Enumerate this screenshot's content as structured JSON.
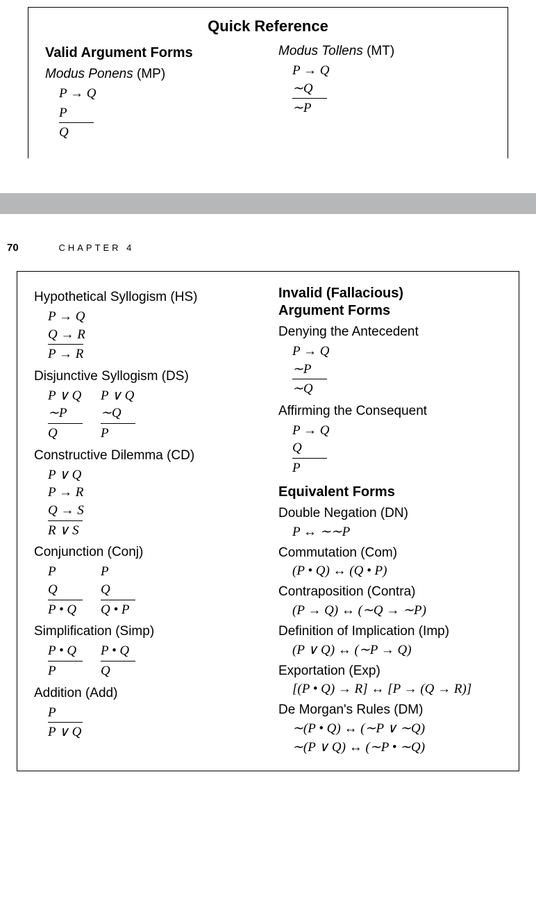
{
  "topBox": {
    "title": "Quick Reference",
    "validHeading": "Valid Argument Forms",
    "mp": {
      "name": "Modus Ponens",
      "abbr": "(MP)",
      "p1": "P → Q",
      "p2": "P",
      "c": "Q"
    },
    "mt": {
      "name": "Modus Tollens",
      "abbr": "(MT)",
      "p1": "P → Q",
      "p2": "∼Q",
      "c": "∼P"
    }
  },
  "pageHeader": {
    "page": "70",
    "chapter": "CHAPTER  4"
  },
  "left": {
    "hs": {
      "name": "Hypothetical Syllogism (HS)",
      "p1": "P → Q",
      "p2": "Q → R",
      "c": "P → R"
    },
    "ds": {
      "name": "Disjunctive Syllogism (DS)",
      "v1": {
        "p1": "P ∨ Q",
        "p2": "∼P",
        "c": "Q"
      },
      "v2": {
        "p1": "P ∨ Q",
        "p2": "∼Q",
        "c": "P"
      }
    },
    "cd": {
      "name": "Constructive Dilemma (CD)",
      "p1": "P ∨ Q",
      "p2": "P → R",
      "p3": "Q → S",
      "c": "R ∨ S"
    },
    "conj": {
      "name": "Conjunction (Conj)",
      "v1": {
        "p1": "P",
        "p2": "Q",
        "c": "P • Q"
      },
      "v2": {
        "p1": "P",
        "p2": "Q",
        "c": "Q • P"
      }
    },
    "simp": {
      "name": "Simplification (Simp)",
      "v1": {
        "p1": "P • Q",
        "c": "P"
      },
      "v2": {
        "p1": "P • Q",
        "c": "Q"
      }
    },
    "add": {
      "name": "Addition (Add)",
      "p1": "P",
      "c": "P ∨ Q"
    }
  },
  "right": {
    "invalidHeading1": "Invalid (Fallacious)",
    "invalidHeading2": "Argument Forms",
    "da": {
      "name": "Denying the Antecedent",
      "p1": "P → Q",
      "p2": "∼P",
      "c": "∼Q"
    },
    "ac": {
      "name": "Affirming the Consequent",
      "p1": "P → Q",
      "p2": "Q",
      "c": "P"
    },
    "equivHeading": "Equivalent Forms",
    "dn": {
      "name": "Double Negation (DN)",
      "eq": "P ↔ ∼∼P"
    },
    "com": {
      "name": "Commutation (Com)",
      "eq": "(P • Q) ↔ (Q • P)"
    },
    "contra": {
      "name": "Contraposition (Contra)",
      "eq": "(P → Q) ↔ (∼Q → ∼P)"
    },
    "imp": {
      "name": "Definition of Implication (Imp)",
      "eq": "(P ∨ Q) ↔ (∼P → Q)"
    },
    "exp": {
      "name": "Exportation (Exp)",
      "eq": "[(P • Q) → R] ↔ [P → (Q → R)]"
    },
    "dm": {
      "name": "De Morgan's Rules (DM)",
      "eq1": "∼(P • Q) ↔ (∼P ∨ ∼Q)",
      "eq2": "∼(P ∨ Q) ↔ (∼P • ∼Q)"
    }
  }
}
